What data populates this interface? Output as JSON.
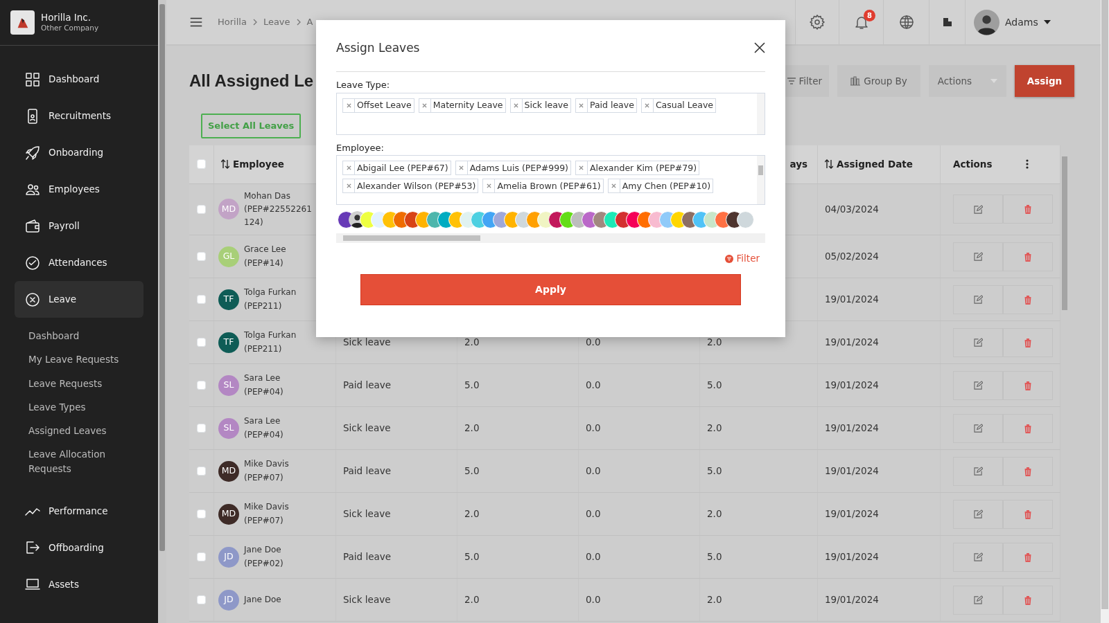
{
  "sidebar": {
    "company": "Horilla Inc.",
    "subtitle": "Other Company",
    "items": [
      {
        "label": "Dashboard",
        "selected": false
      },
      {
        "label": "Recruitments",
        "selected": false
      },
      {
        "label": "Onboarding",
        "selected": false
      },
      {
        "label": "Employees",
        "selected": false
      },
      {
        "label": "Payroll",
        "selected": false
      },
      {
        "label": "Attendances",
        "selected": false
      },
      {
        "label": "Leave",
        "selected": true,
        "children": [
          {
            "label": "Dashboard",
            "selected": false
          },
          {
            "label": "My Leave Requests",
            "selected": false
          },
          {
            "label": "Leave Requests",
            "selected": false
          },
          {
            "label": "Leave Types",
            "selected": false
          },
          {
            "label": "Assigned Leaves",
            "selected": false
          },
          {
            "label": "Leave Allocation Requests",
            "selected": false
          }
        ]
      },
      {
        "label": "Performance",
        "selected": false
      },
      {
        "label": "Offboarding",
        "selected": false
      },
      {
        "label": "Assets",
        "selected": false
      }
    ]
  },
  "topbar": {
    "breadcrumb": [
      "Horilla",
      "Leave",
      "A"
    ],
    "notification_count": "8",
    "user": "Adams"
  },
  "page": {
    "title": "All Assigned Le",
    "select_all": "Select All Leaves",
    "toolbar": [
      {
        "label": "Filter",
        "kind": "filter"
      },
      {
        "label": "Group By",
        "kind": "group"
      },
      {
        "label": "Actions",
        "kind": "dropdown"
      },
      {
        "label": "Assign",
        "kind": "primary"
      }
    ]
  },
  "table": {
    "all_checked": false,
    "columns": [
      {
        "label": "Employee",
        "sortable": true
      },
      {
        "label": "ays",
        "sortable": false
      },
      {
        "label": "Assigned Date",
        "sortable": true
      },
      {
        "label": "Actions",
        "sortable": false
      }
    ],
    "rows": [
      {
        "checked": false,
        "name": "Mohan Das",
        "id_lines": [
          "(PEP#22552261",
          "124)"
        ],
        "initials": "MD",
        "color": "#c2a3c6",
        "assigned_date": "04/03/2024"
      },
      {
        "checked": false,
        "name": "Grace Lee",
        "id_lines": [
          "(PEP#14)"
        ],
        "initials": "GL",
        "color": "#a8cf78",
        "assigned_date": "05/02/2024"
      },
      {
        "checked": false,
        "name": "Tolga Furkan",
        "id_lines": [
          "(PEP211)"
        ],
        "initials": "TF",
        "color": "#0e5c56",
        "assigned_date": "19/01/2024"
      },
      {
        "checked": false,
        "name": "Tolga Furkan",
        "id_lines": [
          "(PEP211)"
        ],
        "initials": "TF",
        "color": "#0e5c56",
        "leave_type": "Sick leave",
        "column_3": "2.0",
        "column_4": "0.0",
        "column_5": "2.0",
        "assigned_date": "19/01/2024"
      },
      {
        "checked": false,
        "name": "Sara Lee",
        "id_lines": [
          "(PEP#04)"
        ],
        "initials": "SL",
        "color": "#b387c3",
        "leave_type": "Paid leave",
        "column_3": "5.0",
        "column_4": "0.0",
        "column_5": "5.0",
        "assigned_date": "19/01/2024"
      },
      {
        "checked": false,
        "name": "Sara Lee",
        "id_lines": [
          "(PEP#04)"
        ],
        "initials": "SL",
        "color": "#b387c3",
        "leave_type": "Sick leave",
        "column_3": "2.0",
        "column_4": "0.0",
        "column_5": "2.0",
        "assigned_date": "19/01/2024"
      },
      {
        "checked": false,
        "name": "Mike Davis",
        "id_lines": [
          "(PEP#07)"
        ],
        "initials": "MD",
        "color": "#3e2b27",
        "leave_type": "Paid leave",
        "column_3": "5.0",
        "column_4": "0.0",
        "column_5": "5.0",
        "assigned_date": "19/01/2024"
      },
      {
        "checked": false,
        "name": "Mike Davis",
        "id_lines": [
          "(PEP#07)"
        ],
        "initials": "MD",
        "color": "#3e2b27",
        "leave_type": "Sick leave",
        "column_3": "2.0",
        "column_4": "0.0",
        "column_5": "2.0",
        "assigned_date": "19/01/2024"
      },
      {
        "checked": false,
        "name": "Jane Doe",
        "id_lines": [
          "(PEP#02)"
        ],
        "initials": "JD",
        "color": "#8e98c8",
        "leave_type": "Paid leave",
        "column_3": "5.0",
        "column_4": "0.0",
        "column_5": "5.0",
        "assigned_date": "19/01/2024"
      },
      {
        "checked": false,
        "name": "Jane Doe",
        "id_lines": [],
        "initials": "JD",
        "color": "#8e98c8",
        "leave_type": "Sick leave",
        "column_3": "2.0",
        "column_4": "0.0",
        "column_5": "2.0",
        "assigned_date": "19/01/2024"
      }
    ]
  },
  "modal": {
    "title": "Assign Leaves",
    "fields": [
      {
        "label": "Leave Type:",
        "tags": [
          "Offset Leave",
          "Maternity Leave",
          "Sick leave",
          "Paid leave",
          "Casual Leave"
        ]
      },
      {
        "label": "Employee:",
        "tags": [
          "Abigail Lee (PEP#67)",
          "Adams Luis (PEP#999)",
          "Alexander Kim (PEP#79)",
          "Alexander Wilson (PEP#53)",
          "Amelia Brown (PEP#61)",
          "Amy Chen (PEP#10)"
        ]
      }
    ],
    "avatars": [
      {
        "kind": "initials",
        "color": "#673ab7"
      },
      {
        "kind": "photo",
        "color": "#cfcfcf"
      },
      {
        "kind": "initials",
        "color": "#eeff41"
      },
      {
        "kind": "initials",
        "color": "#e3f2fd"
      },
      {
        "kind": "initials",
        "color": "#ffc107"
      },
      {
        "kind": "initials",
        "color": "#ef6c00"
      },
      {
        "kind": "initials",
        "color": "#d84315"
      },
      {
        "kind": "initials",
        "color": "#ffb300"
      },
      {
        "kind": "initials",
        "color": "#4db6ac"
      },
      {
        "kind": "initials",
        "color": "#00acc1"
      },
      {
        "kind": "initials",
        "color": "#ffc107"
      },
      {
        "kind": "initials",
        "color": "#e0f2f1"
      },
      {
        "kind": "initials",
        "color": "#4dd0e1"
      },
      {
        "kind": "initials",
        "color": "#42a5f5"
      },
      {
        "kind": "initials",
        "color": "#9fa8da"
      },
      {
        "kind": "initials",
        "color": "#ffb300"
      },
      {
        "kind": "initials",
        "color": "#cfd8dc"
      },
      {
        "kind": "initials",
        "color": "#ffa000"
      },
      {
        "kind": "initials",
        "color": "#f0f4c3"
      },
      {
        "kind": "initials",
        "color": "#c2185b"
      },
      {
        "kind": "initials",
        "color": "#64dd17"
      },
      {
        "kind": "initials",
        "color": "#bdbdbd"
      },
      {
        "kind": "initials",
        "color": "#ba68c8"
      },
      {
        "kind": "initials",
        "color": "#a1887f"
      },
      {
        "kind": "initials",
        "color": "#1de9b6"
      },
      {
        "kind": "initials",
        "color": "#d32f2f"
      },
      {
        "kind": "initials",
        "color": "#f50057"
      },
      {
        "kind": "initials",
        "color": "#ff6d00"
      },
      {
        "kind": "initials",
        "color": "#f8bbd0"
      },
      {
        "kind": "initials",
        "color": "#90caf9"
      },
      {
        "kind": "initials",
        "color": "#ffd600"
      },
      {
        "kind": "initials",
        "color": "#8d6e63"
      },
      {
        "kind": "initials",
        "color": "#4fc3f7"
      },
      {
        "kind": "initials",
        "color": "#c8e6c9"
      },
      {
        "kind": "initials",
        "color": "#ff7043"
      },
      {
        "kind": "initials",
        "color": "#4e342e"
      },
      {
        "kind": "initials",
        "color": "#cfd8dc"
      }
    ],
    "filter": "Filter",
    "apply": "Apply"
  }
}
